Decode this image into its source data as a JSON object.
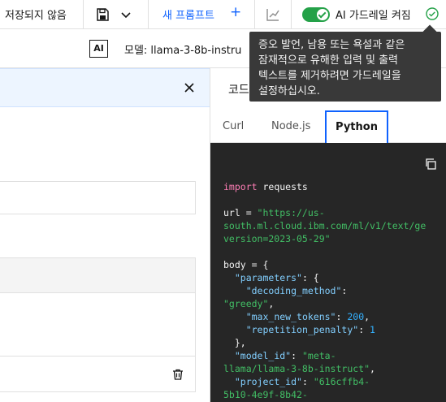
{
  "toolbar": {
    "save_status": "저장되지 않음",
    "new_prompt_label": "새 프롬프트",
    "new_prompt_plus": "+",
    "guardrails_label": "AI 가드레일 켜짐",
    "guardrails_on": true,
    "accent_color": "#0f62fe",
    "toggle_color": "#24a148"
  },
  "model_bar": {
    "badge": "AI",
    "model_label": "모델: llama-3-8b-instru"
  },
  "tooltip": {
    "lines": [
      "증오 발언, 남용 또는 욕설과 같은",
      "잠재적으로 유해한 입력 및 출력",
      "텍스트를 제거하려면 가드레일을",
      "설정하십시오."
    ]
  },
  "code_panel": {
    "title": "코드",
    "tabs": [
      "Curl",
      "Node.js",
      "Python"
    ],
    "active_tab": "Python",
    "code": {
      "kw_import": "import",
      "line1_rest": " requests",
      "url_prefix": "url = ",
      "url_str1": "\"https://us-",
      "url_str2": "south.ml.cloud.ibm.com/ml/v1/text/ge",
      "url_str3": "version=2023-05-29\"",
      "body_open": "body = {",
      "key_parameters": "\"parameters\"",
      "params_open": ": {",
      "key_decoding": "\"decoding_method\"",
      "colon": ":",
      "val_greedy": "\"greedy\"",
      "key_max_tokens": "\"max_new_tokens\"",
      "val_max_tokens": "200",
      "key_rep_penalty": "\"repetition_penalty\"",
      "val_rep_penalty": "1",
      "params_close": "},",
      "key_model_id": "\"model_id\"",
      "val_model_1": "\"meta-",
      "val_model_2": "llama/llama-3-8b-instruct\"",
      "key_project_id": "\"project_id\"",
      "val_project_1": "\"616cffb4-",
      "val_project_2": "5b10-4e9f-8b42-"
    }
  },
  "icons": {
    "save": "save-icon",
    "chevron": "chevron-down-icon",
    "chart": "chart-icon",
    "check": "checkmark-outline-icon",
    "close": "close-icon",
    "copy": "copy-icon",
    "trash": "trash-icon"
  }
}
